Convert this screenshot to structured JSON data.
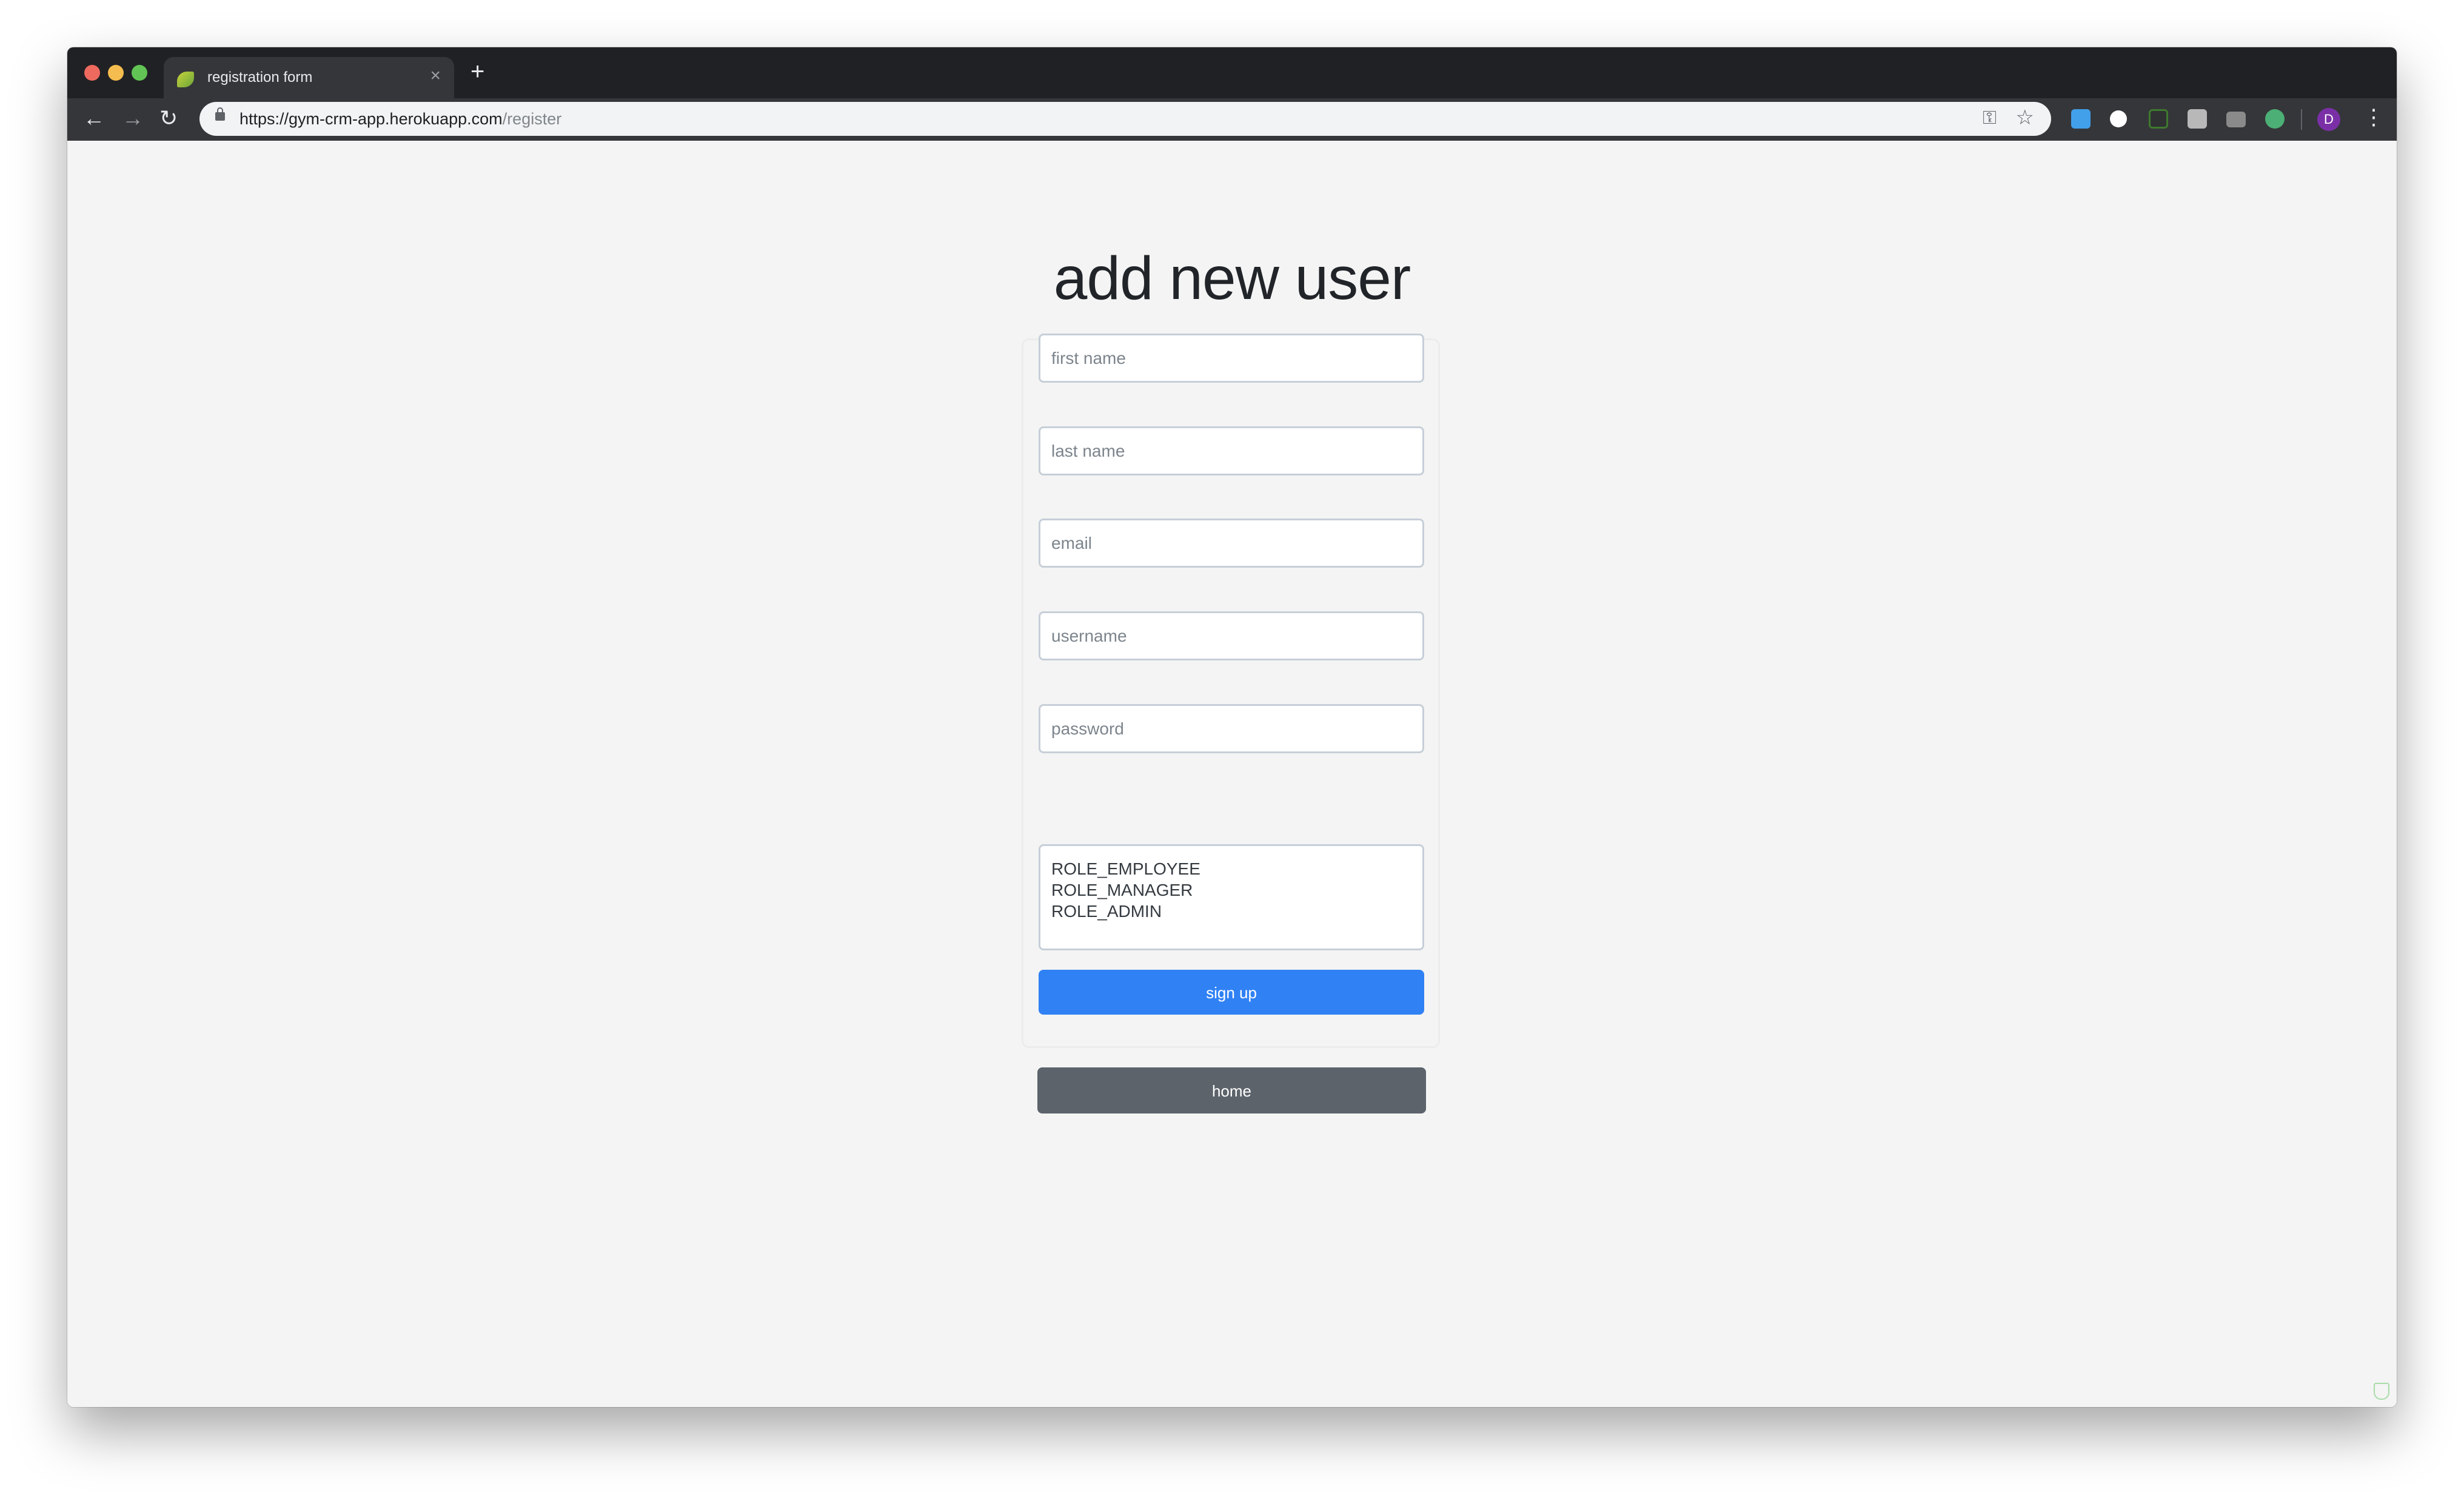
{
  "browser": {
    "tab_title": "registration form",
    "tab_close": "×",
    "new_tab": "+",
    "url_host": "https://gym-crm-app.herokuapp.com",
    "url_path": "/register",
    "back": "←",
    "forward": "→",
    "reload": "↻",
    "key_icon": "⚿",
    "star_icon": "☆",
    "profile_initial": "D",
    "menu": "⋮",
    "extensions": [
      "folder-extension-icon",
      "json-viewer-icon",
      "screenshot-crop-icon",
      "handwriting-extension-icon",
      "camera-icon",
      "grammarly-icon"
    ]
  },
  "page": {
    "title": "add new user",
    "fields": {
      "first_name": {
        "placeholder": "first name",
        "value": ""
      },
      "last_name": {
        "placeholder": "last name",
        "value": ""
      },
      "email": {
        "placeholder": "email",
        "value": ""
      },
      "username": {
        "placeholder": "username",
        "value": ""
      },
      "password": {
        "placeholder": "password",
        "value": ""
      }
    },
    "roles": [
      "ROLE_EMPLOYEE",
      "ROLE_MANAGER",
      "ROLE_ADMIN"
    ],
    "signup_label": "sign up",
    "home_label": "home"
  },
  "colors": {
    "primary": "#3081f4",
    "secondary": "#5c636b",
    "background": "#f4f4f4",
    "browser_frame": "#202124"
  }
}
